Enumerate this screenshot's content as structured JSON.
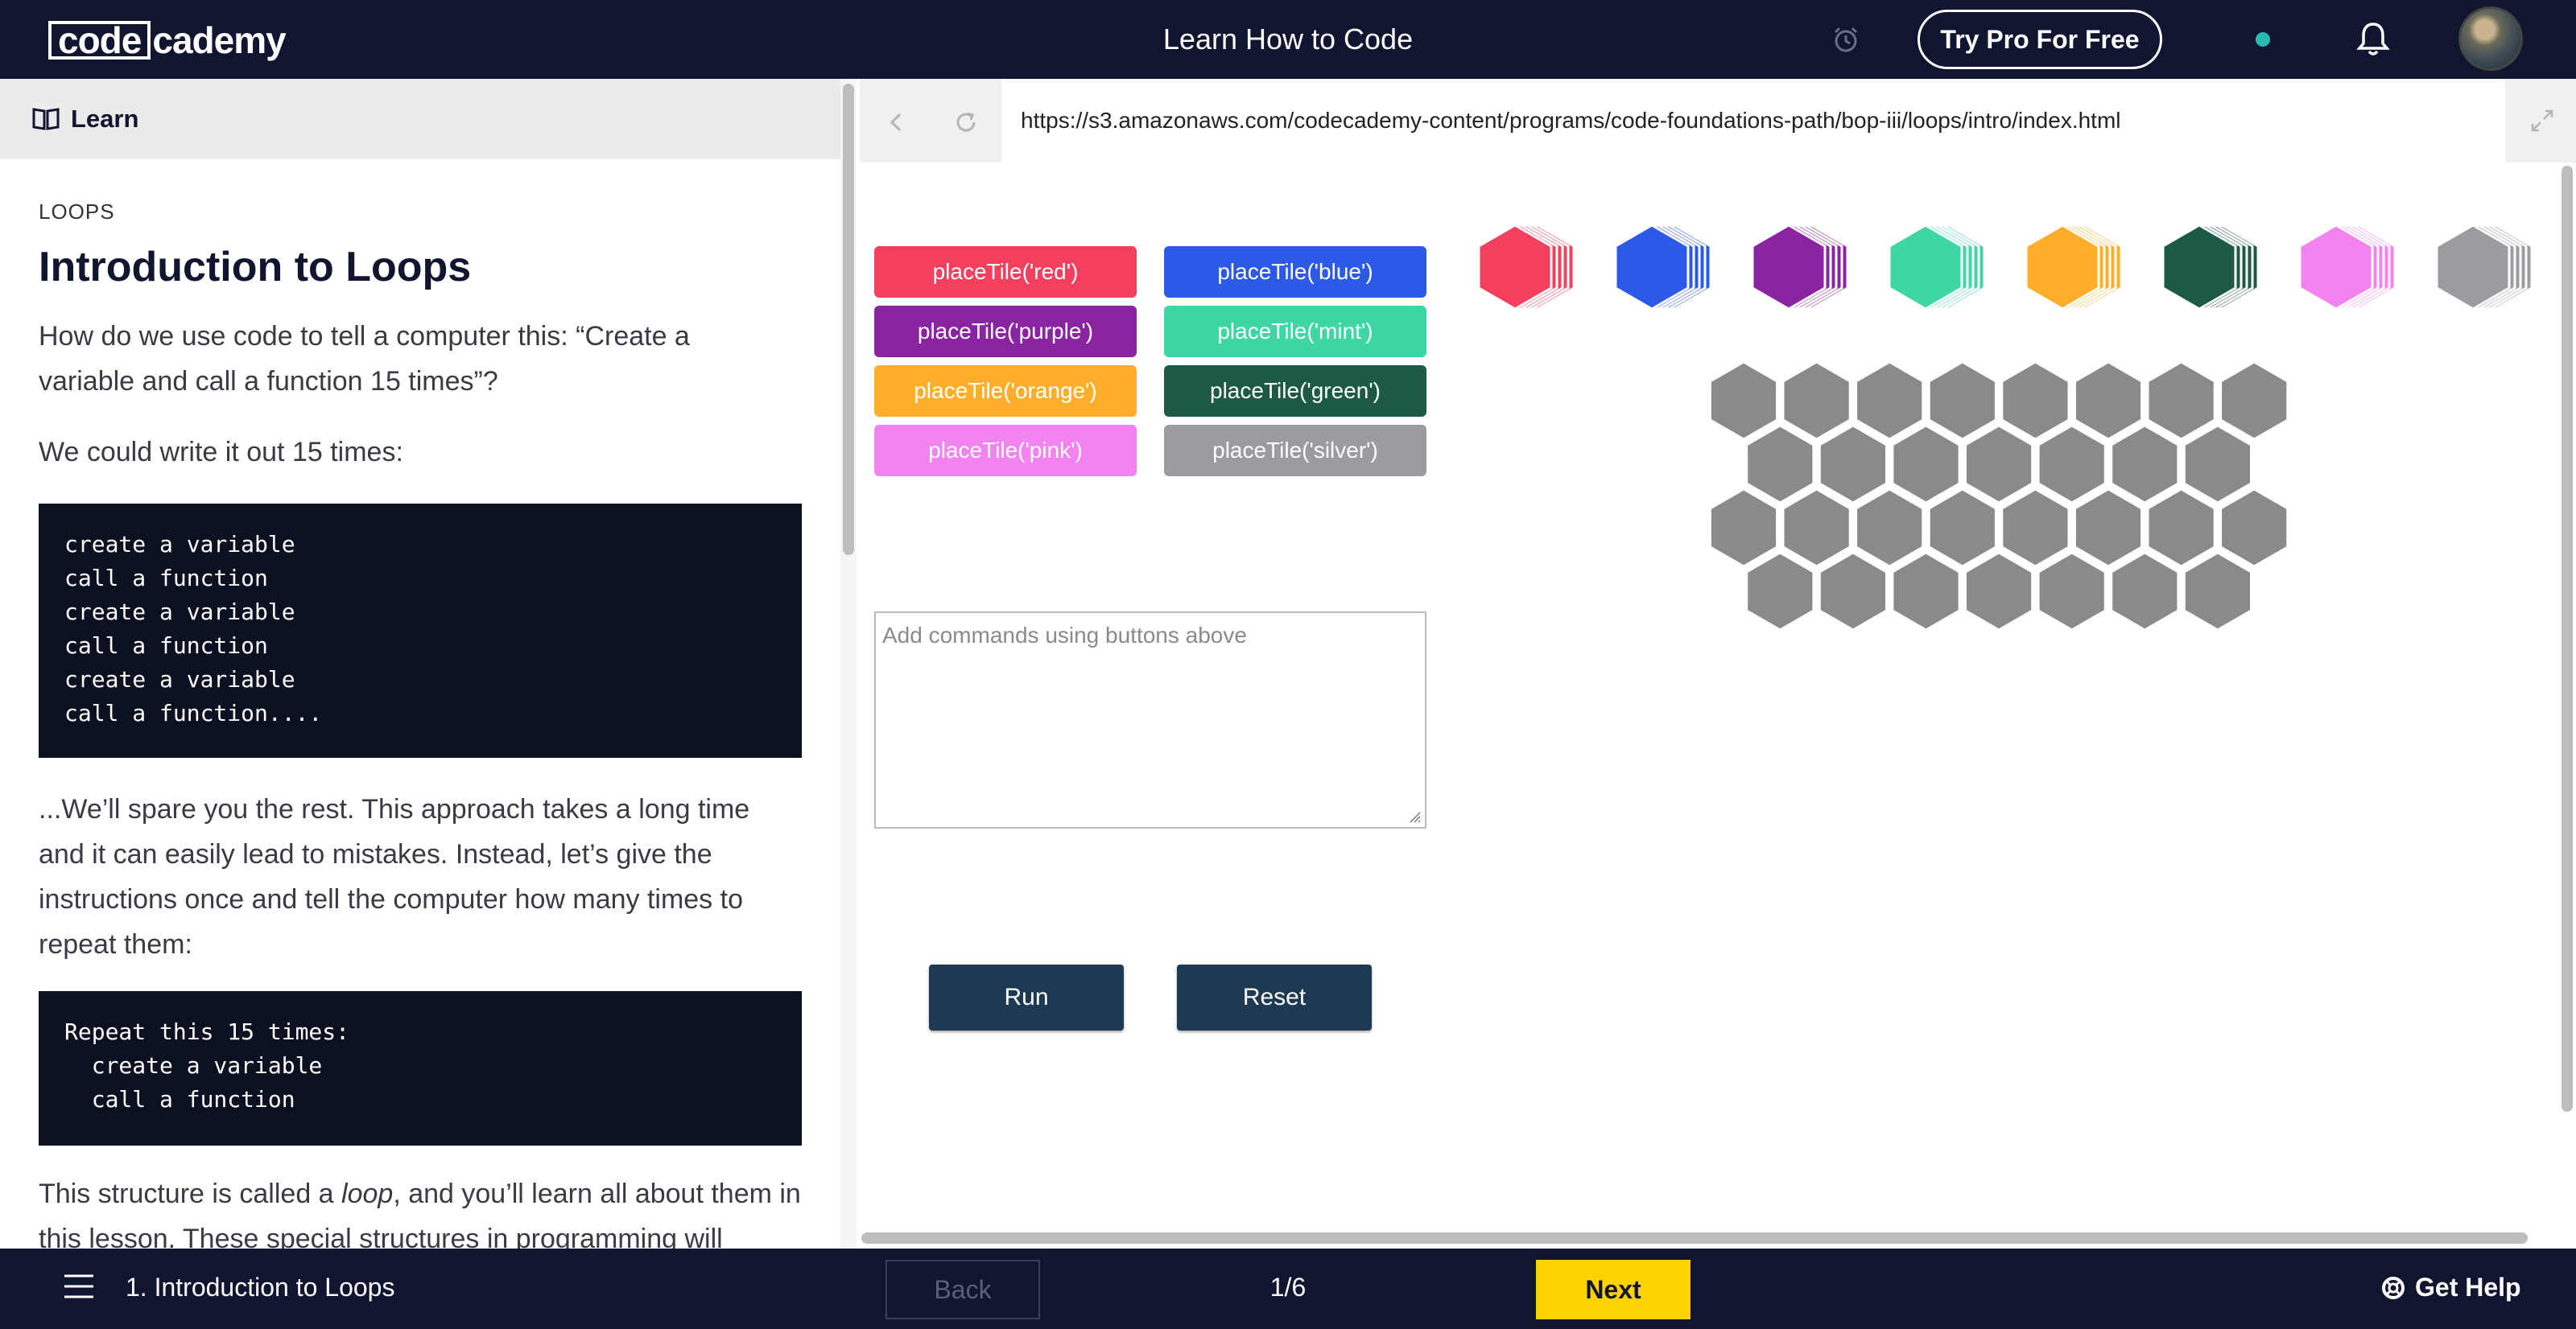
{
  "header": {
    "logo_left": "code",
    "logo_right": "cademy",
    "title": "Learn How to Code",
    "try_pro": "Try Pro For Free"
  },
  "sidebar": {
    "tab_label": "Learn"
  },
  "article": {
    "eyebrow": "LOOPS",
    "title": "Introduction to Loops",
    "p1": "How do we use code to tell a computer this: “Create a variable and call a function 15 times”?",
    "p2": "We could write it out 15 times:",
    "code1": "create a variable\ncall a function\ncreate a variable\ncall a function\ncreate a variable\ncall a function....",
    "p3": "...We’ll spare you the rest. This approach takes a long time and it can easily lead to mistakes. Instead, let’s give the instructions once and tell the computer how many times to repeat them:",
    "code2": "Repeat this 15 times:\n  create a variable\n  call a function",
    "p4_before": "This structure is called a ",
    "p4_em": "loop",
    "p4_after": ", and you’ll learn all about them in this lesson. These special structures in programming will"
  },
  "browser": {
    "url": "https://s3.amazonaws.com/codecademy-content/programs/code-foundations-path/bop-iii/loops/intro/index.html"
  },
  "exercise": {
    "tiles": [
      {
        "label": "placeTile('red')",
        "color": "#f43f5e"
      },
      {
        "label": "placeTile('blue')",
        "color": "#2c5ae6"
      },
      {
        "label": "placeTile('purple')",
        "color": "#8a24a3"
      },
      {
        "label": "placeTile('mint')",
        "color": "#3fd6a5"
      },
      {
        "label": "placeTile('orange')",
        "color": "#ffae2b"
      },
      {
        "label": "placeTile('green')",
        "color": "#1d5a45"
      },
      {
        "label": "placeTile('pink')",
        "color": "#f482f1"
      },
      {
        "label": "placeTile('silver')",
        "color": "#9b9ba0"
      }
    ],
    "commands_placeholder": "Add commands using buttons above",
    "run_label": "Run",
    "reset_label": "Reset",
    "board_color": "#8a8a8a"
  },
  "footer": {
    "lesson": "1. Introduction to Loops",
    "back": "Back",
    "page": "1/6",
    "next": "Next",
    "help": "Get Help"
  }
}
